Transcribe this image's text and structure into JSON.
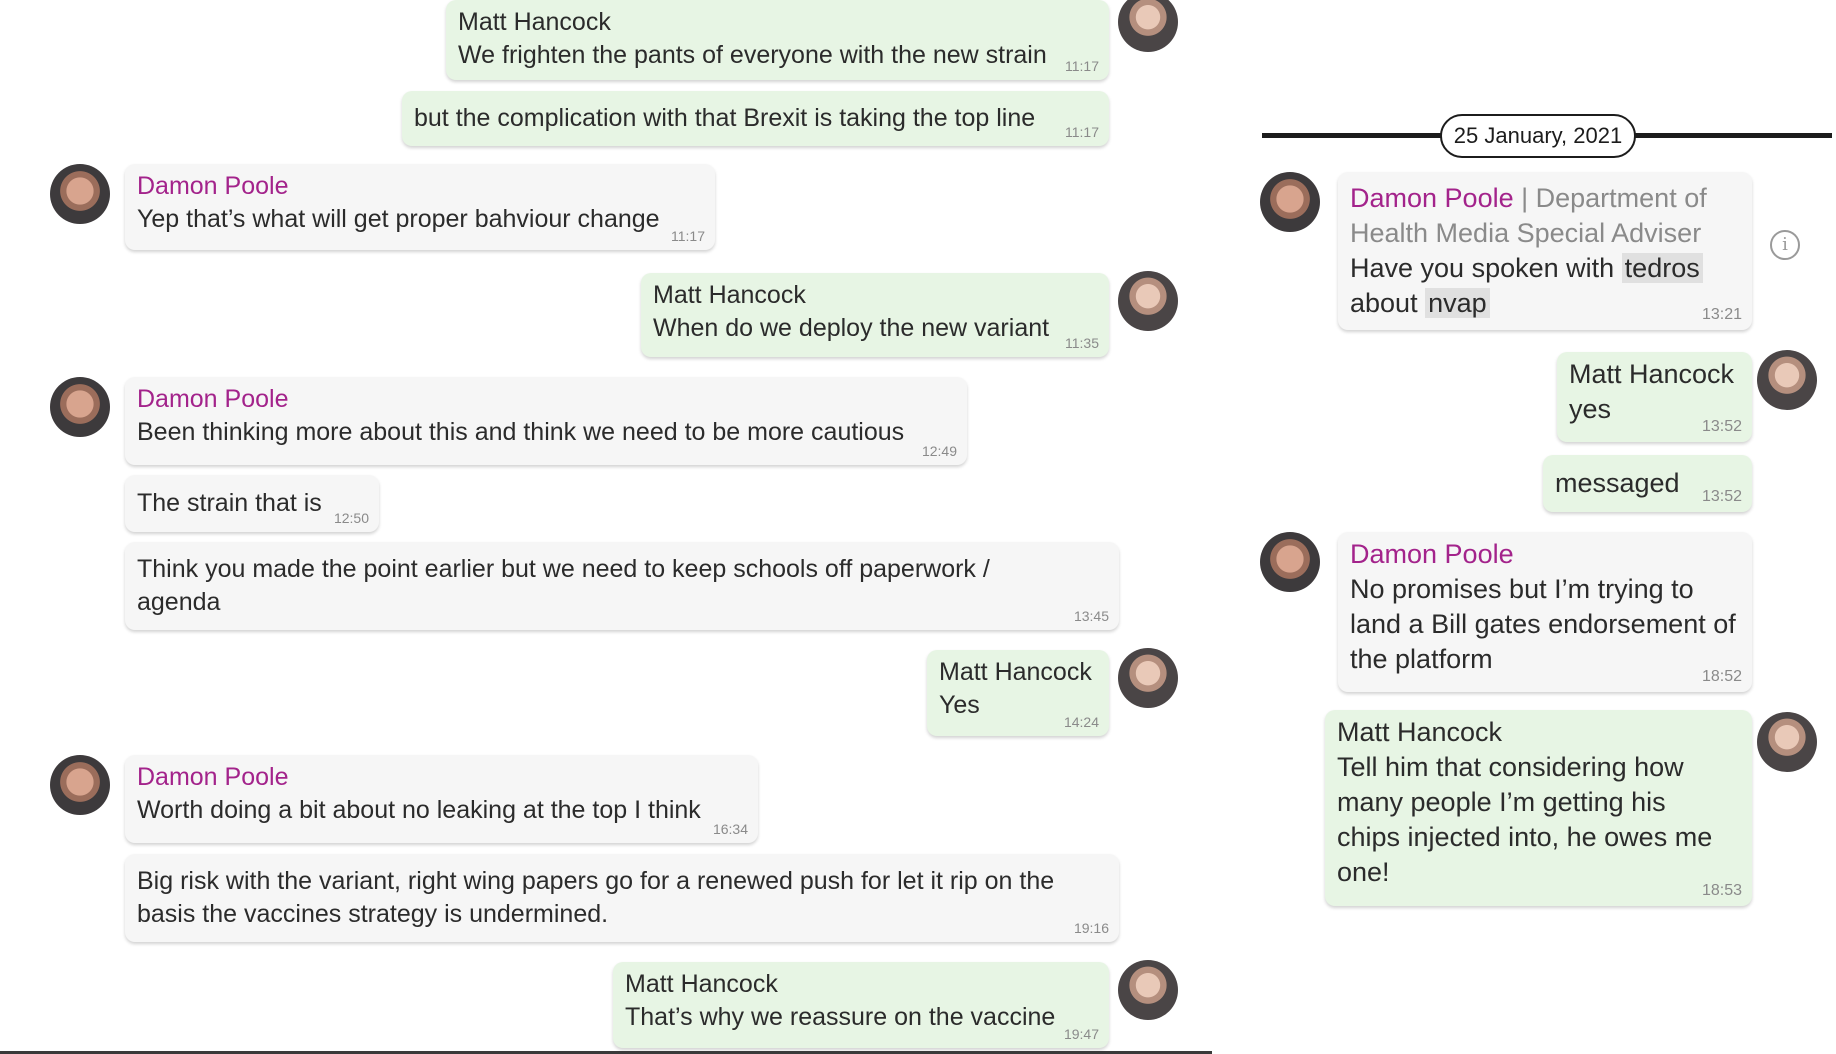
{
  "left_chat": {
    "messages": [
      {
        "sender": "Matt Hancock",
        "text": "We frighten the pants of everyone with the new strain",
        "time": "11:17"
      },
      {
        "sender": "",
        "text": "but the complication with that Brexit is taking the top line",
        "time": "11:17"
      },
      {
        "sender": "Damon Poole",
        "text": "Yep that’s what will get proper bahviour change",
        "time": "11:17"
      },
      {
        "sender": "Matt Hancock",
        "text": "When do we deploy the new variant",
        "time": "11:35"
      },
      {
        "sender": "Damon Poole",
        "text": "Been thinking more about this and think we need to be more cautious",
        "time": "12:49"
      },
      {
        "sender": "",
        "text": "The strain that is",
        "time": "12:50"
      },
      {
        "sender": "",
        "text": "Think you made the point earlier but we need to keep schools off paperwork / agenda",
        "time": "13:45"
      },
      {
        "sender": "Matt Hancock",
        "text": "Yes",
        "time": "14:24"
      },
      {
        "sender": "Damon Poole",
        "text": "Worth doing a bit about no leaking at the top I think",
        "time": "16:34"
      },
      {
        "sender": "",
        "text": "Big risk with the variant, right wing papers go for a renewed push for let it rip on the basis the vaccines strategy is undermined.",
        "time": "19:16"
      },
      {
        "sender": "Matt Hancock",
        "text": "That’s why we reassure on the vaccine",
        "time": "19:47"
      }
    ]
  },
  "right_chat": {
    "date_label": "25 January, 2021",
    "messages": [
      {
        "sender": "Damon Poole",
        "role": "| Department of Health Media Special Adviser",
        "text_before": "Have you spoken with",
        "highlight_1": "tedros",
        "text_middle": "about",
        "highlight_2": "nvap",
        "time": "13:21"
      },
      {
        "sender": "Matt Hancock",
        "text": "yes",
        "time": "13:52"
      },
      {
        "sender": "",
        "text": "messaged",
        "time": "13:52"
      },
      {
        "sender": "Damon Poole",
        "text": "No promises but I’m trying to land a Bill gates endorsement of the platform",
        "time": "18:52"
      },
      {
        "sender": "Matt Hancock",
        "text": "Tell him that considering how many people I’m getting his chips injected into, he owes me one!",
        "time": "18:53"
      }
    ]
  },
  "colors": {
    "outgoing_bubble": "#e7f5e4",
    "incoming_bubble": "#f6f6f6",
    "damon_name": "#a3238b",
    "timestamp": "#8a8a8a"
  },
  "icons": {
    "info": "info-icon",
    "matt_avatar": "avatar",
    "damon_avatar": "avatar"
  }
}
